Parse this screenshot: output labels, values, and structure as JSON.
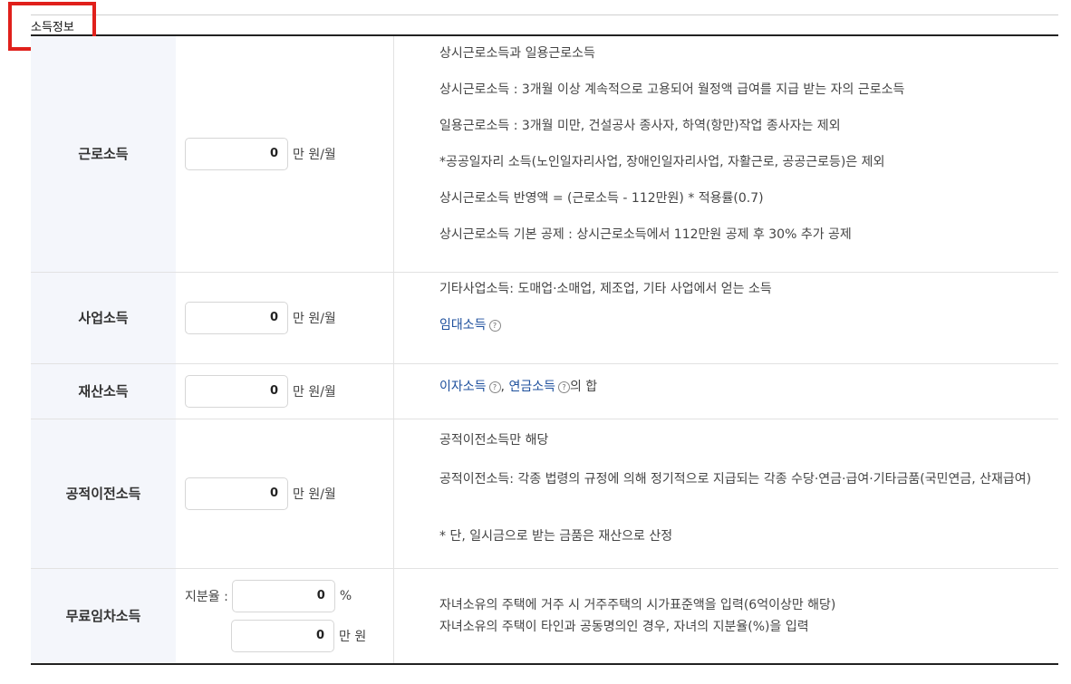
{
  "section": {
    "title": "소득정보"
  },
  "rows": [
    {
      "label": "근로소득",
      "value": "0",
      "unit": "만 원/월",
      "desc": [
        "상시근로소득과 일용근로소득",
        "상시근로소득 : 3개월 이상 계속적으로 고용되어 월정액 급여를 지급 받는 자의 근로소득",
        "일용근로소득 : 3개월 미만, 건설공사 종사자, 하역(항만)작업 종사자는 제외",
        "*공공일자리 소득(노인일자리사업, 장애인일자리사업, 자활근로, 공공근로등)은 제외",
        "상시근로소득 반영액 = (근로소득 - 112만원) * 적용률(0.7)",
        "상시근로소득 기본 공제 : 상시근로소득에서 112만원 공제 후 30% 추가 공제"
      ]
    },
    {
      "label": "사업소득",
      "value": "0",
      "unit": "만 원/월",
      "desc": [
        "기타사업소득: 도매업·소매업, 제조업, 기타 사업에서 얻는 소득"
      ],
      "link": "임대소득"
    },
    {
      "label": "재산소득",
      "value": "0",
      "unit": "만 원/월",
      "link1": "이자소득",
      "sep": ",",
      "link2": "연금소득",
      "suffix": "의 합"
    },
    {
      "label": "공적이전소득",
      "value": "0",
      "unit": "만 원/월",
      "desc": [
        "공적이전소득만 해당",
        "공적이전소득: 각종 법령의 규정에 의해 정기적으로 지급되는 각종 수당·연금·급여·기타금품(국민연금, 산재급여)",
        "* 단, 일시금으로 받는 금품은 재산으로 산정"
      ]
    },
    {
      "label": "무료임차소득",
      "rate_label": "지분율 :",
      "rate_value": "0",
      "rate_unit": "%",
      "value": "0",
      "unit": "만 원",
      "desc": [
        "자녀소유의 주택에 거주 시 거주주택의 시가표준액을 입력(6억이상만 해당)",
        "자녀소유의 주택이 타인과 공동명의인 경우, 자녀의 지분율(%)을 입력"
      ]
    }
  ],
  "icons": {
    "help": "question-circle-icon",
    "help_glyph": "?"
  },
  "colors": {
    "highlight": "#e0201b",
    "link": "#1d4f9c",
    "label_bg": "#f4f6fb"
  }
}
